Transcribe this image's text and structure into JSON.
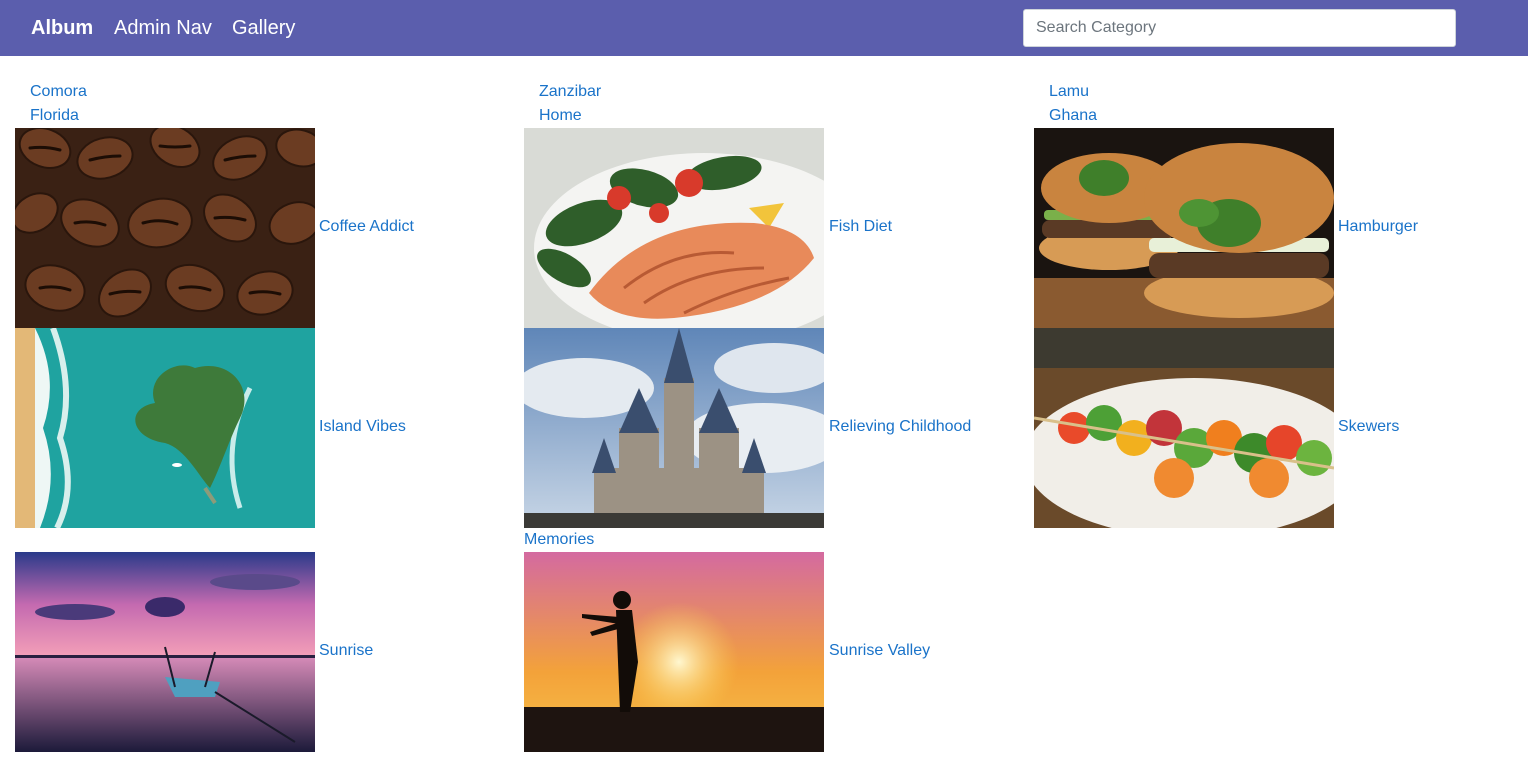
{
  "navbar": {
    "brand": "Album",
    "links": [
      "Admin Nav",
      "Gallery"
    ],
    "search_placeholder": "Search Category",
    "background": "#5b5ead"
  },
  "categories": {
    "col1": [
      "Comora",
      "Florida"
    ],
    "col2": [
      "Zanzibar",
      "Home"
    ],
    "col3": [
      "Lamu",
      "Ghana"
    ]
  },
  "albums": [
    {
      "title": "Coffee Addict",
      "image": "coffee-beans"
    },
    {
      "title": "Fish Diet",
      "image": "salmon-salad-plate"
    },
    {
      "title": "Hamburger",
      "image": "burgers-with-basil"
    },
    {
      "title": "Island Vibes",
      "image": "heart-shaped-island"
    },
    {
      "title": "Relieving Childhood",
      "image": "fairytale-castle"
    },
    {
      "title": "Skewers",
      "image": "vegetable-skewers"
    },
    {
      "title": "Sunrise",
      "image": "boat-on-purple-sea"
    },
    {
      "title": "Sunrise Valley",
      "image": "silhouette-at-sunrise"
    }
  ],
  "extra_link": "Memories",
  "link_color": "#1a73c9"
}
